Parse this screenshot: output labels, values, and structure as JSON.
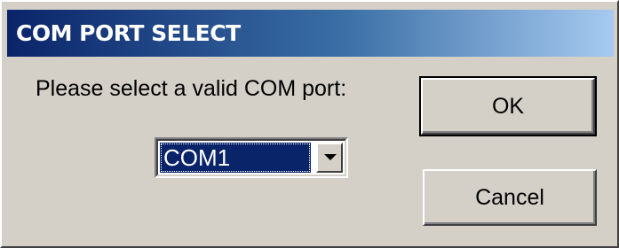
{
  "window": {
    "title": "COM PORT SELECT"
  },
  "dialog": {
    "prompt": "Please select a valid COM port:",
    "com_port_select": {
      "selected_value": "COM1"
    },
    "ok_label": "OK",
    "cancel_label": "Cancel"
  },
  "colors": {
    "title_bar_start": "#0a246a",
    "title_bar_end": "#a6caf0",
    "dialog_background": "#d4d0c8",
    "selection_highlight": "#0a246a"
  },
  "icons": {
    "dropdown": "chevron-down-icon"
  }
}
